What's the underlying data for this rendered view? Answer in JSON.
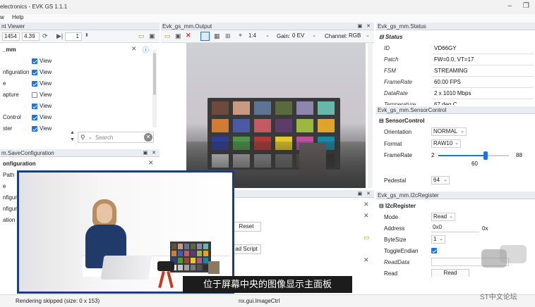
{
  "window": {
    "title": "electronics - EVK GS 1.1.1",
    "minimize_glyph": "–",
    "restore_glyph": "❐"
  },
  "menu": {
    "items": [
      "w",
      "Help"
    ]
  },
  "viewer": {
    "panel_title": "nt Viewer",
    "frame_value": "1454",
    "fps_value": "4.39",
    "page_value": "1",
    "root_label": "_mm",
    "rows": [
      {
        "label": "",
        "checked": true,
        "text": "View"
      },
      {
        "label": "nfiguration",
        "checked": true,
        "text": "View"
      },
      {
        "label": "e",
        "checked": true,
        "text": "View"
      },
      {
        "label": "apture",
        "checked": false,
        "text": "View"
      },
      {
        "label": "",
        "checked": true,
        "text": "View"
      },
      {
        "label": "Control",
        "checked": true,
        "text": "View"
      },
      {
        "label": "ster",
        "checked": true,
        "text": "View"
      }
    ],
    "search_placeholder": "Search"
  },
  "save_config": {
    "panel_title": "m.SaveConfiguration",
    "section": "onfiguration",
    "rows": [
      "Path",
      "e",
      "nfigur",
      "nfigur",
      "ation"
    ]
  },
  "output": {
    "panel_title": "Evk_gs_mm.Output",
    "zoom": "1:4",
    "gain_label": "Gain:",
    "gain_value": "0 EV",
    "channel_label": "Channel:",
    "channel_value": "RGB"
  },
  "script_panel": {
    "reset_label": "Reset",
    "load_script_label": "ad Script"
  },
  "status": {
    "panel_title": "Evk_gs_mm.Status",
    "section": "Status",
    "rows": [
      {
        "label": "ID",
        "value": "VD66GY"
      },
      {
        "label": "Patch",
        "value": "FW=0.0, VT=17"
      },
      {
        "label": "FSM",
        "value": "STREAMING"
      },
      {
        "label": "FrameRate",
        "value": "60.00 FPS"
      },
      {
        "label": "DataRate",
        "value": "2 x 1010 Mbps"
      },
      {
        "label": "Temperature",
        "value": "67 deg C"
      }
    ]
  },
  "sensor_control": {
    "panel_title": "Evk_gs_mm.SensorControl",
    "section": "SensorControl",
    "orientation_label": "Orientation",
    "orientation_value": "NORMAL",
    "format_label": "Format",
    "format_value": "RAW10",
    "framerate_label": "FrameRate",
    "framerate_min": "2",
    "framerate_max": "88",
    "framerate_value": "60",
    "framerate_fraction": 0.67,
    "pedestal_label": "Pedestal",
    "pedestal_value": "64"
  },
  "i2c": {
    "panel_title": "Evk_gs_mm.I2cRegister",
    "section": "I2cRegister",
    "mode_label": "Mode",
    "mode_value": "Read",
    "address_label": "Address",
    "address_value": "0x0",
    "address_suffix": "0x",
    "bytesize_label": "ByteSize",
    "bytesize_value": "1",
    "toggle_label": "ToggleEndian",
    "toggle_checked": true,
    "readdata_label": "ReadData",
    "read_label": "Read",
    "read_button": "Read"
  },
  "statusbar": {
    "message": "Rendering skipped (size: 0 x 153)",
    "component": "nx.gui.ImageCtrl"
  },
  "caption": "位于屏幕中央的图像显示主面板",
  "watermark": "ST中文论坛",
  "colors": {
    "accent": "#1a73e8",
    "panel_header": "#e9edf2",
    "video_border": "#1f3d7a",
    "caption_bg": "#1c1c1c"
  }
}
